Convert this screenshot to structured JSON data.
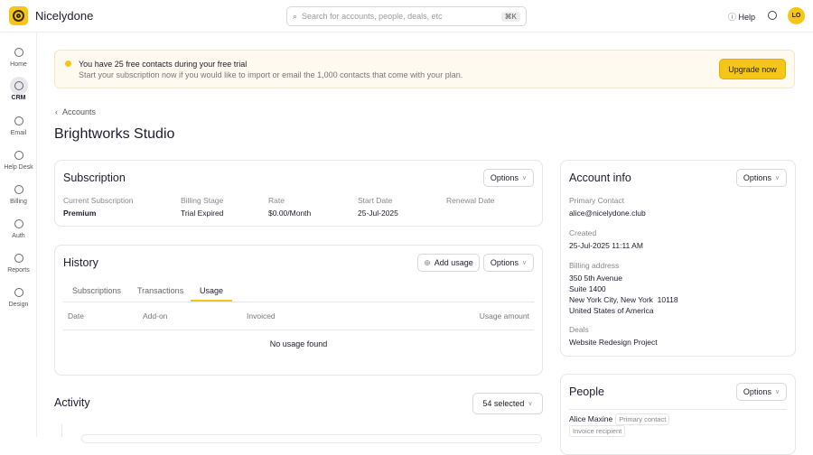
{
  "header": {
    "brand": "Nicelydone",
    "search_placeholder": "Search for accounts, people, deals, etc",
    "search_shortcut": "⌘K",
    "help": "Help",
    "avatar": "LO"
  },
  "sidebar": {
    "items": [
      {
        "label": "Home"
      },
      {
        "label": "CRM"
      },
      {
        "label": "Email"
      },
      {
        "label": "Help Desk"
      },
      {
        "label": "Billing"
      },
      {
        "label": "Auth"
      },
      {
        "label": "Reports"
      },
      {
        "label": "Design"
      }
    ]
  },
  "banner": {
    "title": "You have 25 free contacts during your free trial",
    "text": "Start your subscription now if you would like to import or email the 1,000 contacts that come with your plan.",
    "button": "Upgrade now"
  },
  "breadcrumb": "Accounts",
  "page_title": "Brightworks Studio",
  "subscription": {
    "title": "Subscription",
    "options": "Options",
    "fields": [
      {
        "label": "Current Subscription",
        "value": "Premium"
      },
      {
        "label": "Billing Stage",
        "value": "Trial Expired"
      },
      {
        "label": "Rate",
        "value": "$0.00/Month"
      },
      {
        "label": "Start Date",
        "value": "25-Jul-2025"
      },
      {
        "label": "Renewal Date",
        "value": ""
      }
    ]
  },
  "history": {
    "title": "History",
    "add_usage": "Add usage",
    "options": "Options",
    "tabs": [
      "Subscriptions",
      "Transactions",
      "Usage"
    ],
    "columns": [
      "Date",
      "Add-on",
      "Invoiced",
      "Usage amount"
    ],
    "empty": "No usage found"
  },
  "activity": {
    "title": "Activity",
    "filter": "54 selected"
  },
  "account_info": {
    "title": "Account info",
    "options": "Options",
    "primary_contact_label": "Primary Contact",
    "primary_contact": "alice@nicelydone.club",
    "created_label": "Created",
    "created": "25-Jul-2025 11:11 AM",
    "billing_label": "Billing address",
    "address": [
      "350 5th Avenue",
      "Suite 1400",
      "New York City, New York  10118",
      "United States of America"
    ],
    "deals_label": "Deals",
    "deal": "Website Redesign Project"
  },
  "people": {
    "title": "People",
    "options": "Options",
    "person": {
      "name": "Alice Maxine",
      "tags": [
        "Primary contact",
        "Invoice recipient"
      ]
    }
  },
  "colors": {
    "accent": "#f5c518"
  }
}
